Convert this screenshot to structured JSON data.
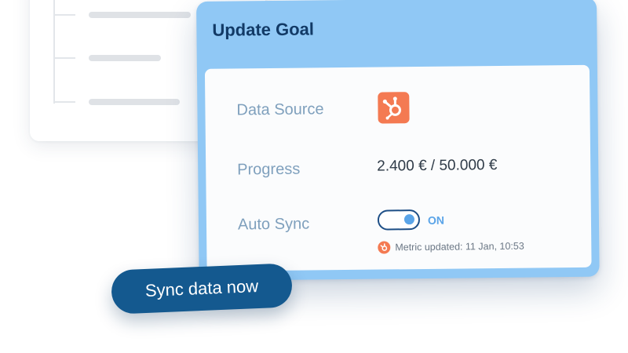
{
  "modal": {
    "title": "Update Goal",
    "fields": {
      "data_source_label": "Data Source",
      "data_source_icon": "hubspot-icon",
      "progress_label": "Progress",
      "progress_value": "2.400 € / 50.000 €",
      "auto_sync_label": "Auto Sync",
      "auto_sync_state": "ON",
      "auto_sync_on": true,
      "metric_updated": "Metric updated: 11 Jan, 10:53"
    }
  },
  "actions": {
    "sync_label": "Sync data now"
  },
  "colors": {
    "modal_header": "#90c8f5",
    "title_text": "#123a66",
    "brand_orange": "#f47a52",
    "primary_button": "#14598f",
    "toggle_accent": "#5aa4e8"
  }
}
